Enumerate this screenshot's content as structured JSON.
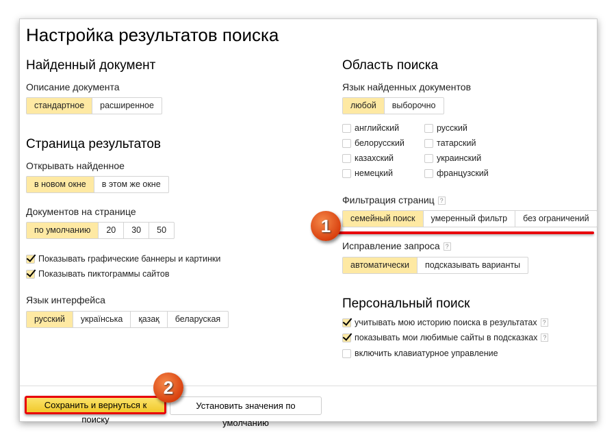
{
  "title": "Настройка результатов поиска",
  "left": {
    "found_doc": {
      "heading": "Найденный документ",
      "desc_label": "Описание документа",
      "options": [
        "стандартное",
        "расширенное"
      ],
      "selected": 0
    },
    "results_page": {
      "heading": "Страница результатов",
      "open_label": "Открывать найденное",
      "open_options": [
        "в новом окне",
        "в этом же окне"
      ],
      "open_selected": 0,
      "docs_label": "Документов на странице",
      "docs_options": [
        "по умолчанию",
        "20",
        "30",
        "50"
      ],
      "docs_selected": 0,
      "checks": [
        {
          "label": "Показывать графические баннеры и картинки",
          "checked": true
        },
        {
          "label": "Показывать пиктограммы сайтов",
          "checked": true
        }
      ]
    },
    "interface_lang": {
      "label": "Язык интерфейса",
      "options": [
        "русский",
        "українська",
        "қазақ",
        "беларуская"
      ],
      "selected": 0
    }
  },
  "right": {
    "search_area": {
      "heading": "Область поиска",
      "lang_label": "Язык найденных документов",
      "lang_options": [
        "любой",
        "выборочно"
      ],
      "lang_selected": 0,
      "languages": [
        {
          "label": "английский",
          "checked": false
        },
        {
          "label": "русский",
          "checked": false
        },
        {
          "label": "белорусский",
          "checked": false
        },
        {
          "label": "татарский",
          "checked": false
        },
        {
          "label": "казахский",
          "checked": false
        },
        {
          "label": "украинский",
          "checked": false
        },
        {
          "label": "немецкий",
          "checked": false
        },
        {
          "label": "французский",
          "checked": false
        }
      ]
    },
    "filter": {
      "label": "Фильтрация страниц",
      "help": "?",
      "options": [
        "семейный поиск",
        "умеренный фильтр",
        "без ограничений"
      ],
      "selected": 0
    },
    "correction": {
      "label": "Исправление запроса",
      "help": "?",
      "options": [
        "автоматически",
        "подсказывать варианты"
      ],
      "selected": 0
    },
    "personal": {
      "heading": "Персональный поиск",
      "checks": [
        {
          "label": "учитывать мою историю поиска в результатах",
          "checked": true,
          "help": "?"
        },
        {
          "label": "показывать мои любимые сайты в подсказках",
          "checked": true,
          "help": "?"
        },
        {
          "label": "включить клавиатурное управление",
          "checked": false
        }
      ]
    }
  },
  "footer": {
    "save": "Сохранить и вернуться к поиску",
    "reset": "Установить значения по умолчанию"
  },
  "annotations": {
    "badge1": "1",
    "badge2": "2",
    "highlight_color": "#e8000b"
  },
  "colors": {
    "selected": "#fee9a3",
    "save_button": "#f6d23f"
  }
}
